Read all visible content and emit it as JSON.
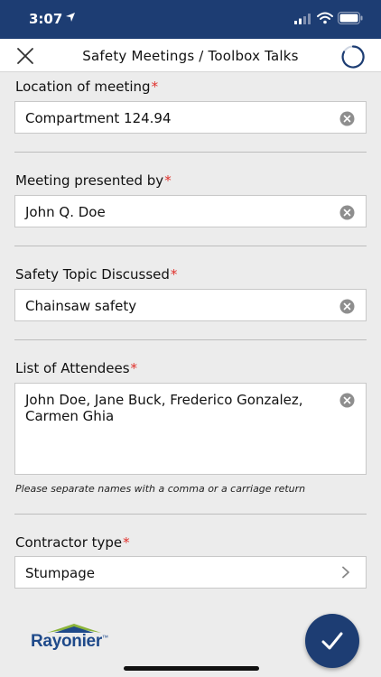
{
  "status": {
    "time": "3:07"
  },
  "nav": {
    "title": "Safety Meetings / Toolbox Talks"
  },
  "fields": {
    "location": {
      "label": "Location of meeting",
      "required": "*",
      "value": "Compartment 124.94"
    },
    "presenter": {
      "label": "Meeting presented by",
      "required": "*",
      "value": "John Q. Doe"
    },
    "topic": {
      "label": "Safety Topic Discussed",
      "required": "*",
      "value": "Chainsaw safety"
    },
    "attendees": {
      "label": "List of Attendees",
      "required": "*",
      "value": "John Doe, Jane Buck, Frederico Gonzalez,\nCarmen Ghia",
      "hint": "Please separate names with a comma or a carriage return"
    },
    "contractor": {
      "label": "Contractor type",
      "required": "*",
      "value": "Stumpage"
    }
  },
  "footer": {
    "brand": "Rayonier",
    "brand_mark": "™"
  },
  "icons": {
    "close": "close-icon",
    "spinner": "loading-spinner-icon",
    "clear": "clear-circle-icon",
    "chevron": "chevron-right-icon",
    "submit": "checkmark-icon"
  },
  "colors": {
    "header": "#1d3d73",
    "required": "#e0302b",
    "brand_blue": "#1f4a8a",
    "brand_green": "#8bb43a"
  }
}
